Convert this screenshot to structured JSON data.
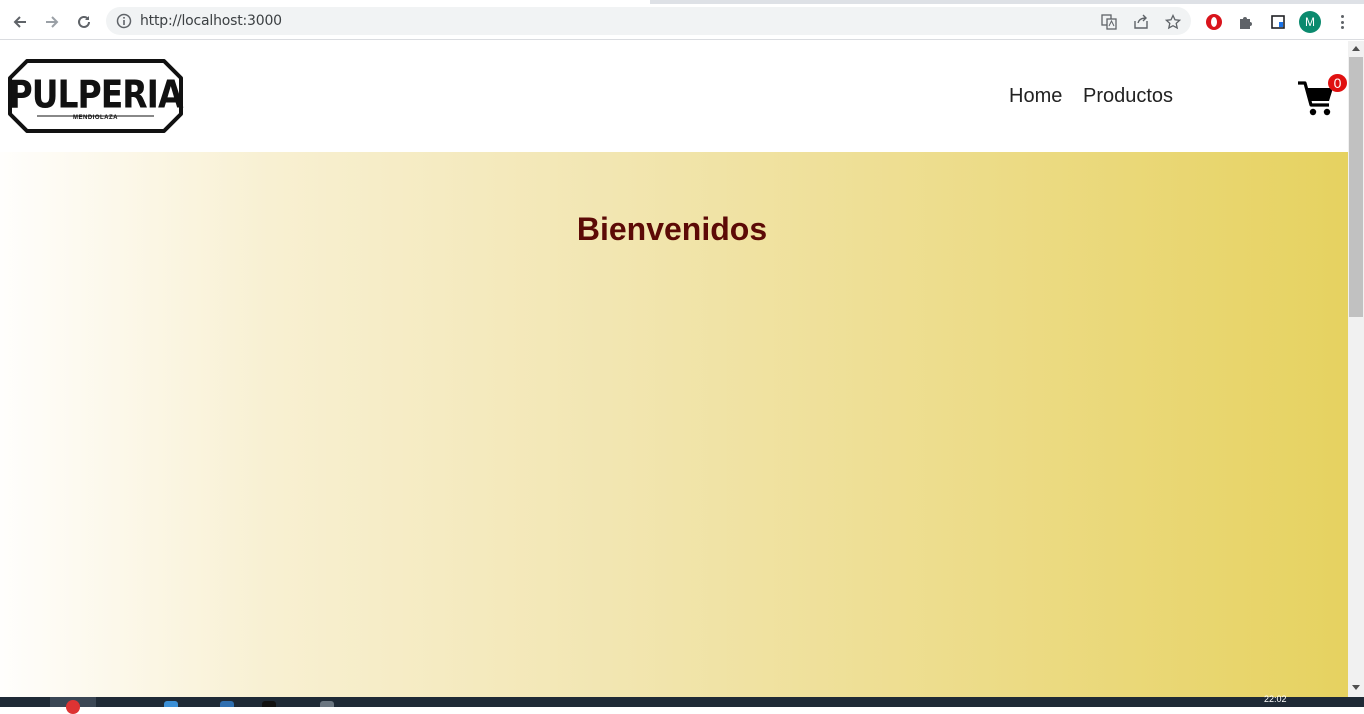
{
  "browser": {
    "url": "http://localhost:3000",
    "profile_initial": "M",
    "icons": [
      "back-arrow-icon",
      "forward-arrow-icon",
      "reload-icon",
      "info-icon",
      "translate-icon",
      "share-icon",
      "star-icon",
      "opera-icon",
      "puzzle-icon",
      "sidepanel-icon",
      "menu-kebab-icon"
    ]
  },
  "header": {
    "logo_text": "PULPERIA",
    "logo_subtext": "MENDIOLAZA",
    "nav": {
      "home": "Home",
      "productos": "Productos"
    },
    "cart_count": "0"
  },
  "hero": {
    "title": "Bienvenidos"
  },
  "taskbar": {
    "clock": "22:02"
  },
  "colors": {
    "title": "#5c0a06",
    "badge": "#e01010",
    "gradient_start": "#fffefc",
    "gradient_end": "#e6d260"
  }
}
